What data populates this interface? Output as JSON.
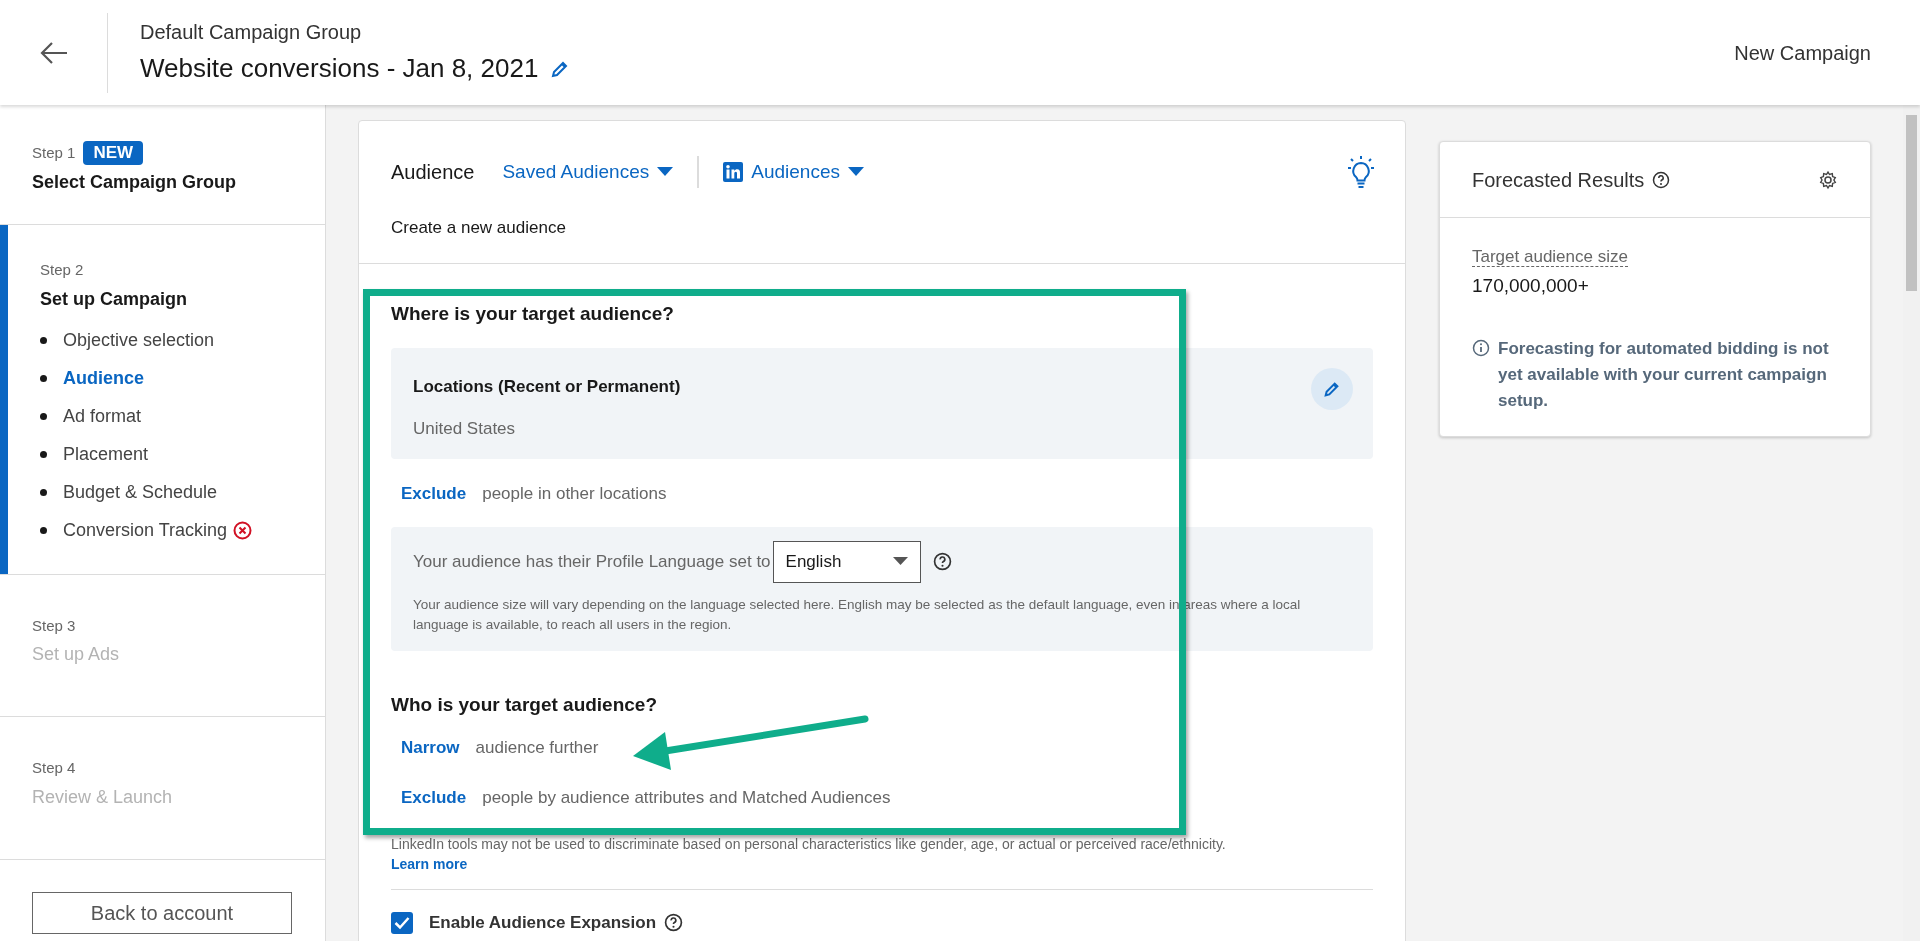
{
  "header": {
    "group": "Default Campaign Group",
    "title": "Website conversions - Jan 8, 2021",
    "action": "New Campaign"
  },
  "sidebar": {
    "steps": [
      {
        "step": "Step 1",
        "badge": "NEW",
        "title": "Select Campaign Group",
        "selected": false,
        "disabled": false
      },
      {
        "step": "Step 2",
        "title": "Set up Campaign",
        "selected": true,
        "disabled": false,
        "items": [
          {
            "label": "Objective selection",
            "selected": false,
            "error": false
          },
          {
            "label": "Audience",
            "selected": true,
            "error": false
          },
          {
            "label": "Ad format",
            "selected": false,
            "error": false
          },
          {
            "label": "Placement",
            "selected": false,
            "error": false
          },
          {
            "label": "Budget & Schedule",
            "selected": false,
            "error": false
          },
          {
            "label": "Conversion Tracking",
            "selected": false,
            "error": true
          }
        ]
      },
      {
        "step": "Step 3",
        "title": "Set up Ads",
        "selected": false,
        "disabled": true
      },
      {
        "step": "Step 4",
        "title": "Review & Launch",
        "selected": false,
        "disabled": true
      }
    ],
    "button": "Back to account"
  },
  "audience": {
    "title": "Audience",
    "dropdowns": [
      {
        "label": "Saved Audiences",
        "kind": "plain"
      },
      {
        "label": "Audiences",
        "kind": "brand"
      }
    ],
    "subtitle": "Create a new audience",
    "where": {
      "heading": "Where is your target audience?",
      "location": {
        "title": "Locations (Recent or Permanent)",
        "value": "United States"
      },
      "row": {
        "action": "Exclude",
        "text": "people in other locations"
      }
    },
    "language": {
      "prefix": "Your audience has their Profile Language set to",
      "value": "English",
      "hint": "Your audience size will vary depending on the language selected here. English may be selected as the default language, even in areas where a local language is available, to reach all users in the region."
    },
    "who": {
      "heading": "Who is your target audience?",
      "rows": [
        {
          "action": "Narrow",
          "text": "audience further"
        },
        {
          "action": "Exclude",
          "text": "people by audience attributes and Matched Audiences"
        }
      ]
    },
    "disclaimer": {
      "text": "LinkedIn tools may not be used to discriminate based on personal characteristics like gender, age, or actual or perceived race/ethnicity.",
      "link": "Learn more"
    },
    "expansion": {
      "label": "Enable Audience Expansion",
      "checked": true
    }
  },
  "forecast": {
    "title": "Forecasted Results",
    "metric_label": "Target audience size",
    "metric_value": "170,000,000+",
    "note": "Forecasting for automated bidding is not yet available with your current campaign setup."
  }
}
